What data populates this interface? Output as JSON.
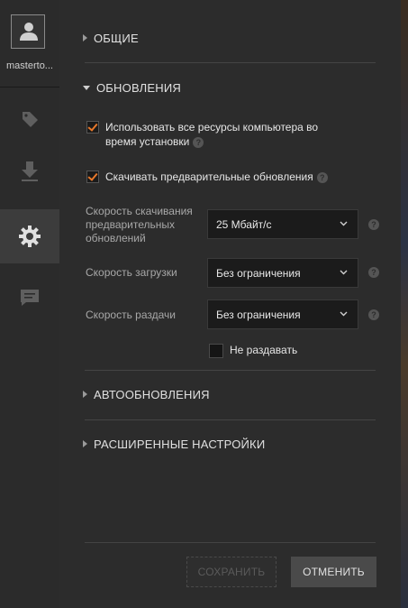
{
  "sidebar": {
    "username": "masterto...",
    "items": [
      {
        "icon": "tag-icon"
      },
      {
        "icon": "download-icon"
      },
      {
        "icon": "gear-icon",
        "active": true
      },
      {
        "icon": "chat-icon"
      }
    ]
  },
  "sections": {
    "general": "ОБЩИЕ",
    "updates": "ОБНОВЛЕНИЯ",
    "autoupdates": "АВТООБНОВЛЕНИЯ",
    "advanced": "РАСШИРЕННЫЕ НАСТРОЙКИ"
  },
  "updates": {
    "use_all_resources": {
      "label_line1": "Использовать все ресурсы компьютера во",
      "label_line2": "время установки",
      "checked": true
    },
    "predownload": {
      "label": "Скачивать предварительные обновления",
      "checked": true
    },
    "predownload_speed": {
      "label_line1": "Скорость скачивания",
      "label_line2": "предварительных",
      "label_line3": "обновлений",
      "value": "25 Мбайт/с"
    },
    "download_speed": {
      "label": "Скорость загрузки",
      "value": "Без ограничения"
    },
    "upload_speed": {
      "label": "Скорость раздачи",
      "value": "Без ограничения"
    },
    "no_seeding": {
      "label": "Не раздавать",
      "checked": false
    }
  },
  "help_glyph": "?",
  "buttons": {
    "save": "СОХРАНИТЬ",
    "cancel": "ОТМЕНИТЬ"
  },
  "colors": {
    "accent": "#e8782a",
    "panel": "#2c2c2c",
    "sidebar": "#2b2b2b"
  }
}
